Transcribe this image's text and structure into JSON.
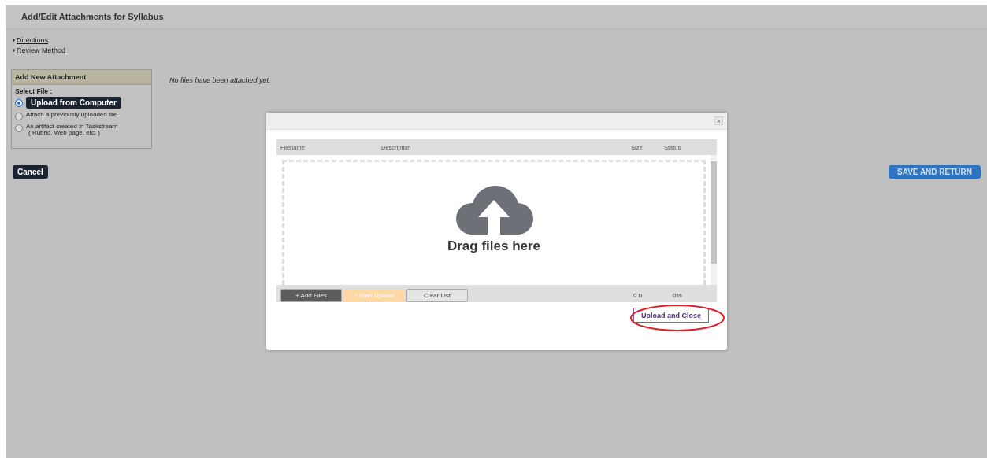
{
  "page": {
    "title": "Add/Edit Attachments for Syllabus"
  },
  "links": [
    {
      "label": "Directions",
      "expanded": false
    },
    {
      "label": "Review Method",
      "expanded": false
    }
  ],
  "attachment_panel": {
    "title": "Add New Attachment",
    "select_label": "Select File :",
    "options": [
      {
        "label": "Upload from Computer",
        "selected": true
      },
      {
        "label": "Attach a previously uploaded file",
        "selected": false
      },
      {
        "label": "An artifact created in Taskstream",
        "note": "( Rubric, Web page, etc. )",
        "selected": false
      }
    ]
  },
  "empty_message": "No files have been attached yet.",
  "cancel_button": "Cancel",
  "save_button": "SAVE AND RETURN",
  "dialog": {
    "close": "×",
    "columns": [
      "Filename",
      "Description",
      "Size",
      "Status"
    ],
    "drop_text": "Drag files here",
    "buttons": [
      {
        "label": "+ Add Files",
        "kind": "dark",
        "disabled": false
      },
      {
        "label": "↑ Start Upload",
        "kind": "orange",
        "disabled": true
      },
      {
        "label": "Clear List",
        "kind": "light",
        "disabled": false
      }
    ],
    "total_size": "0 b",
    "total_status": "0%",
    "upload_close_button": "Upload and Close"
  }
}
